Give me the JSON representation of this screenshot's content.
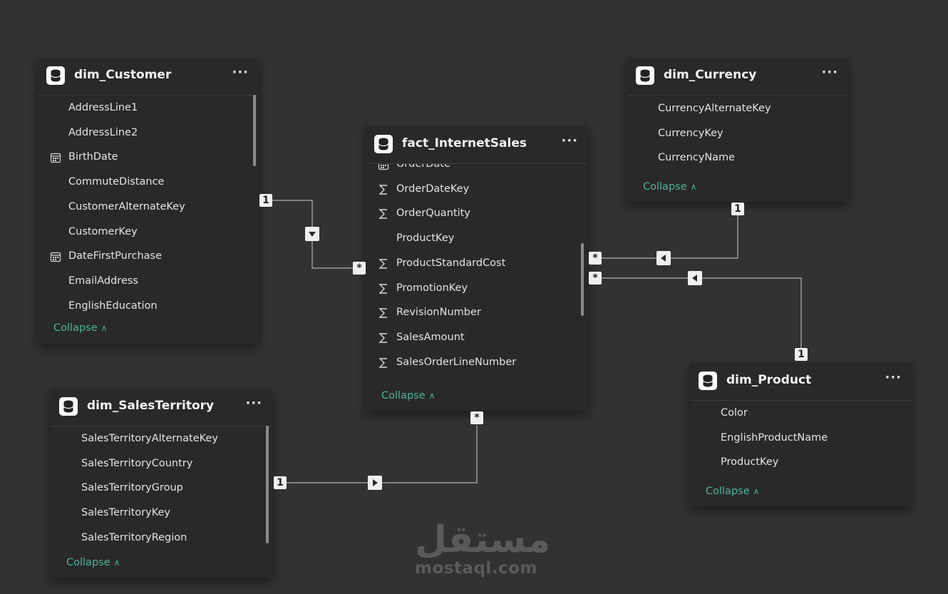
{
  "tables": {
    "dim_customer": {
      "title": "dim_Customer",
      "more": "···",
      "fields": [
        {
          "name": "AddressLine1",
          "icon": ""
        },
        {
          "name": "AddressLine2",
          "icon": ""
        },
        {
          "name": "BirthDate",
          "icon": "calendar-icon"
        },
        {
          "name": "CommuteDistance",
          "icon": ""
        },
        {
          "name": "CustomerAlternateKey",
          "icon": ""
        },
        {
          "name": "CustomerKey",
          "icon": ""
        },
        {
          "name": "DateFirstPurchase",
          "icon": "calendar-icon"
        },
        {
          "name": "EmailAddress",
          "icon": ""
        },
        {
          "name": "EnglishEducation",
          "icon": ""
        }
      ],
      "collapse": "Collapse"
    },
    "fact_internet_sales": {
      "title": "fact_InternetSales",
      "more": "···",
      "fields": [
        {
          "name": "OrderDate",
          "icon": "calendar-icon"
        },
        {
          "name": "OrderDateKey",
          "icon": "sigma-icon"
        },
        {
          "name": "OrderQuantity",
          "icon": "sigma-icon"
        },
        {
          "name": "ProductKey",
          "icon": ""
        },
        {
          "name": "ProductStandardCost",
          "icon": "sigma-icon"
        },
        {
          "name": "PromotionKey",
          "icon": "sigma-icon"
        },
        {
          "name": "RevisionNumber",
          "icon": "sigma-icon"
        },
        {
          "name": "SalesAmount",
          "icon": "sigma-icon"
        },
        {
          "name": "SalesOrderLineNumber",
          "icon": "sigma-icon"
        }
      ],
      "collapse": "Collapse"
    },
    "dim_currency": {
      "title": "dim_Currency",
      "more": "···",
      "fields": [
        {
          "name": "CurrencyAlternateKey",
          "icon": ""
        },
        {
          "name": "CurrencyKey",
          "icon": ""
        },
        {
          "name": "CurrencyName",
          "icon": ""
        }
      ],
      "collapse": "Collapse"
    },
    "dim_sales_territory": {
      "title": "dim_SalesTerritory",
      "more": "···",
      "fields": [
        {
          "name": "SalesTerritoryAlternateKey",
          "icon": ""
        },
        {
          "name": "SalesTerritoryCountry",
          "icon": ""
        },
        {
          "name": "SalesTerritoryGroup",
          "icon": ""
        },
        {
          "name": "SalesTerritoryKey",
          "icon": ""
        },
        {
          "name": "SalesTerritoryRegion",
          "icon": ""
        }
      ],
      "collapse": "Collapse"
    },
    "dim_product": {
      "title": "dim_Product",
      "more": "···",
      "fields": [
        {
          "name": "Color",
          "icon": ""
        },
        {
          "name": "EnglishProductName",
          "icon": ""
        },
        {
          "name": "ProductKey",
          "icon": ""
        }
      ],
      "collapse": "Collapse"
    }
  },
  "relationships": [
    {
      "from": "dim_Customer",
      "to": "fact_InternetSales",
      "one_label": "1",
      "many_label": "*",
      "direction": "down"
    },
    {
      "from": "dim_Currency",
      "to": "fact_InternetSales",
      "one_label": "1",
      "many_label": "*",
      "direction": "left"
    },
    {
      "from": "dim_Product",
      "to": "fact_InternetSales",
      "one_label": "1",
      "many_label": "*",
      "direction": "left"
    },
    {
      "from": "dim_SalesTerritory",
      "to": "fact_InternetSales",
      "one_label": "1",
      "many_label": "*",
      "direction": "right"
    }
  ],
  "watermark": {
    "arabic": "مستقل",
    "latin": "mostaql.com"
  }
}
